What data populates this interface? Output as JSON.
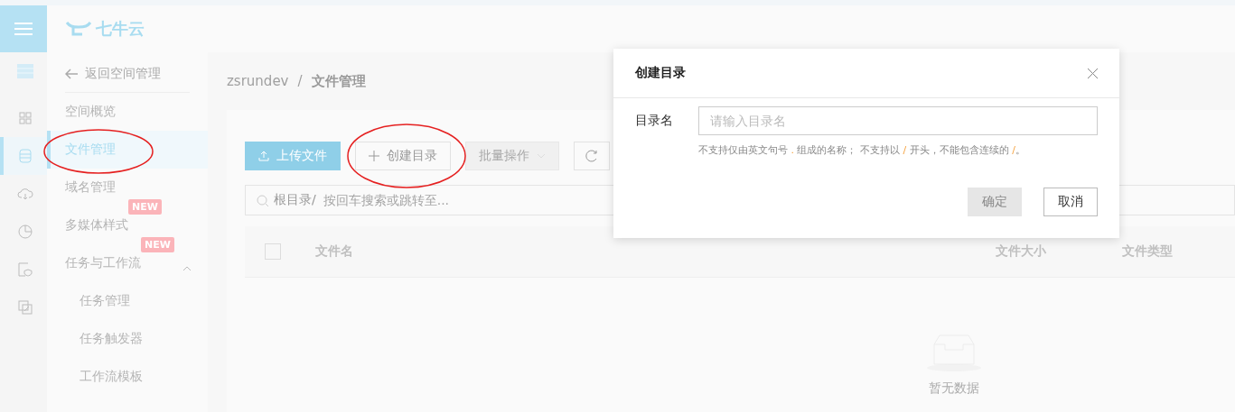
{
  "header": {
    "logo_text": "七牛云"
  },
  "icon_rail": [
    {
      "kind": "buckets",
      "selected": false
    },
    {
      "kind": "grid",
      "selected": false
    },
    {
      "kind": "database",
      "selected": true
    },
    {
      "kind": "cloud",
      "selected": false
    },
    {
      "kind": "pie",
      "selected": false
    },
    {
      "kind": "doc",
      "selected": false
    },
    {
      "kind": "tag",
      "selected": false
    }
  ],
  "sidebar": {
    "back": "返回空间管理",
    "items": [
      {
        "label": "空间概览",
        "selected": false
      },
      {
        "label": "文件管理",
        "selected": true
      },
      {
        "label": "域名管理",
        "selected": false
      },
      {
        "label": "多媒体样式",
        "selected": false,
        "badge": "NEW"
      },
      {
        "label": "任务与工作流",
        "selected": false,
        "badge": "NEW",
        "expanded": true,
        "children": [
          {
            "label": "任务管理",
            "selected": false
          },
          {
            "label": "任务触发器",
            "selected": false
          },
          {
            "label": "工作流模板",
            "selected": false
          }
        ]
      }
    ]
  },
  "breadcrumb": [
    "zsrundev",
    "文件管理"
  ],
  "breadcrumb_separator": "/",
  "toolbar": [
    {
      "kind": "primary",
      "label": "上传文件",
      "disabled": false
    },
    {
      "kind": "add",
      "label": "创建目录",
      "disabled": false
    },
    {
      "kind": "dropdown",
      "label": "批量操作",
      "disabled": true
    },
    {
      "kind": "refresh",
      "disabled": false
    }
  ],
  "search": {
    "prefix": "根目录/",
    "placeholder": "按回车搜索或跳转至..."
  },
  "table": {
    "select_all": {
      "checked": false
    },
    "columns": [
      "文件名",
      "文件大小",
      "文件类型"
    ],
    "empty_text": "暂无数据"
  },
  "dialog": {
    "title": "创建目录",
    "field_label": "目录名",
    "placeholder": "请输入目录名",
    "hint": [
      {
        "text": "不支持仅由英文句号 ",
        "accent": false
      },
      {
        "text": ".",
        "accent": true
      },
      {
        "text": " 组成的名称； 不支持以 ",
        "accent": false
      },
      {
        "text": "/",
        "accent": true
      },
      {
        "text": " 开头，不能包含连续的 ",
        "accent": false
      },
      {
        "text": "/",
        "accent": true
      },
      {
        "text": "。",
        "accent": false
      }
    ],
    "buttons": [
      {
        "label": "确定",
        "disabled": true
      },
      {
        "label": "取消",
        "disabled": false
      }
    ]
  }
}
